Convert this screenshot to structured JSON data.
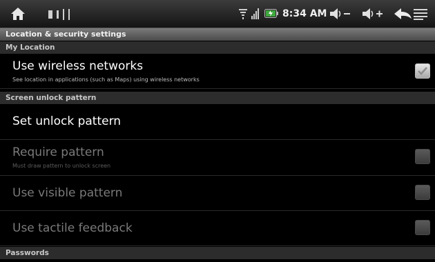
{
  "status_bar": {
    "time": "8:34 AM",
    "icons": [
      "home-icon",
      "notification-icons",
      "wifi-icon",
      "signal-icon",
      "battery-icon",
      "volume-down-icon",
      "volume-up-icon",
      "back-icon",
      "menu-icon"
    ]
  },
  "title": "Location & security settings",
  "sections": {
    "my_location": "My Location",
    "screen_unlock": "Screen unlock pattern",
    "passwords": "Passwords"
  },
  "settings": {
    "wireless": {
      "title": "Use wireless networks",
      "summary": "See location in applications (such as Maps) using wireless networks",
      "checked": true
    },
    "set_unlock": {
      "title": "Set unlock pattern"
    },
    "require_pattern": {
      "title": "Require pattern",
      "summary": "Must draw pattern to unlock screen",
      "checked": false,
      "enabled": false
    },
    "visible_pattern": {
      "title": "Use visible pattern",
      "checked": false,
      "enabled": false
    },
    "tactile_feedback": {
      "title": "Use tactile feedback",
      "checked": false,
      "enabled": false
    }
  },
  "colors": {
    "background": "#000000",
    "title_bar": "#5e5e5e",
    "section_header": "#2c2c2c",
    "text_primary": "#ffffff",
    "text_disabled": "#7a7a7a"
  }
}
